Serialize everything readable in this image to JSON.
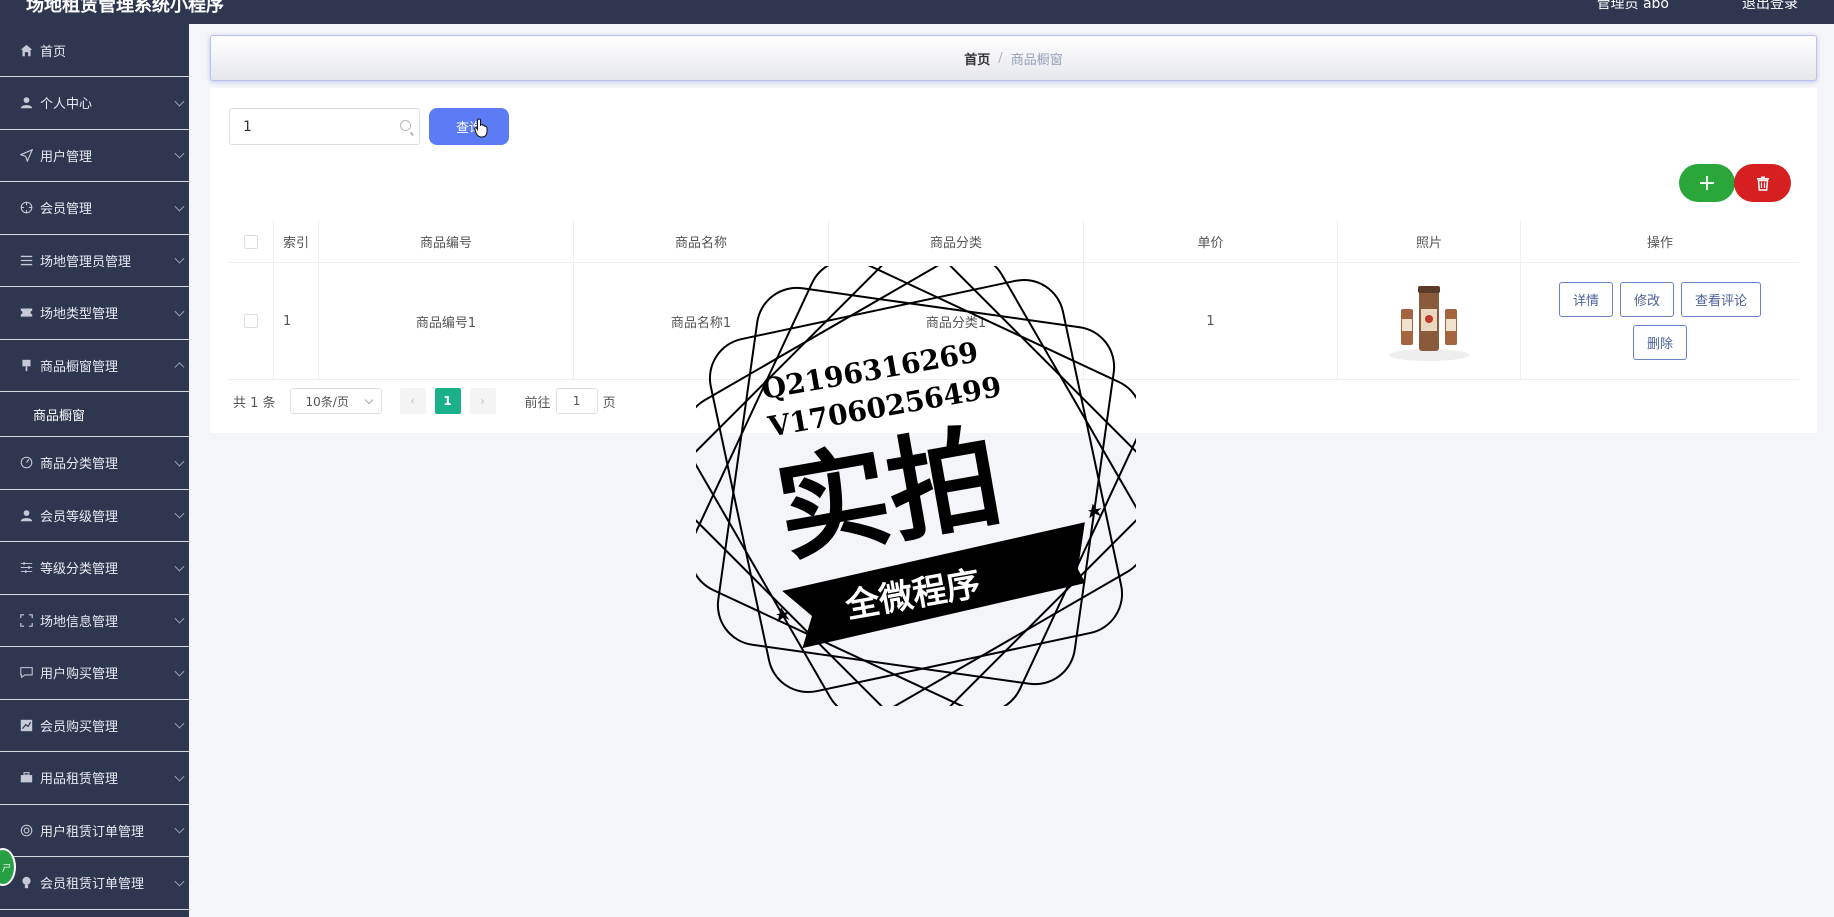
{
  "header": {
    "app_title": "场地租赁管理系统小程序",
    "user_label": "管理员 abo",
    "logout_label": "退出登录"
  },
  "sidebar": {
    "items": [
      {
        "label": "首页",
        "icon": "home-icon"
      },
      {
        "label": "个人中心",
        "icon": "user-icon"
      },
      {
        "label": "用户管理",
        "icon": "send-icon"
      },
      {
        "label": "会员管理",
        "icon": "target-icon"
      },
      {
        "label": "场地管理员管理",
        "icon": "list-icon"
      },
      {
        "label": "场地类型管理",
        "icon": "ticket-icon"
      },
      {
        "label": "商品橱窗管理",
        "icon": "pin-icon"
      },
      {
        "label": "商品分类管理",
        "icon": "gauge-icon"
      },
      {
        "label": "会员等级管理",
        "icon": "user-icon"
      },
      {
        "label": "等级分类管理",
        "icon": "sliders-icon"
      },
      {
        "label": "场地信息管理",
        "icon": "frame-icon"
      },
      {
        "label": "用户购买管理",
        "icon": "chat-icon"
      },
      {
        "label": "会员购买管理",
        "icon": "chart-icon"
      },
      {
        "label": "用品租赁管理",
        "icon": "briefcase-icon"
      },
      {
        "label": "用户租赁订单管理",
        "icon": "ring-icon"
      },
      {
        "label": "会员租赁订单管理",
        "icon": "bulb-icon"
      }
    ],
    "sub_item": "商品橱窗"
  },
  "breadcrumb": {
    "home": "首页",
    "separator": "/",
    "current": "商品橱窗"
  },
  "search": {
    "value": "1",
    "button_label": "查询"
  },
  "actions": {
    "add_symbol": "+",
    "delete_icon": "trash-icon"
  },
  "table": {
    "headers": [
      "",
      "索引",
      "商品编号",
      "商品名称",
      "商品分类",
      "单价",
      "照片",
      "操作"
    ],
    "rows": [
      {
        "index": "1",
        "code": "商品编号1",
        "name": "商品名称1",
        "category": "商品分类1",
        "price": "1",
        "photo_icon": "product-photo"
      }
    ],
    "row_buttons": {
      "detail": "详情",
      "edit": "修改",
      "review": "查看评论",
      "delete": "删除"
    }
  },
  "pagination": {
    "total": "共 1 条",
    "page_size": "10条/页",
    "current_page": "1",
    "goto_prefix": "前往",
    "goto_value": "1",
    "goto_suffix": "页"
  },
  "watermark": {
    "line1": "Q2196316269",
    "line2": "V17060256499",
    "big_text": "实拍",
    "ribbon": "全微程序"
  },
  "colors": {
    "sidebar_bg": "#2f3650",
    "query_button": "#5c7cf5",
    "add_button": "#2aa63a",
    "delete_button": "#d51f20",
    "active_page": "#19b08a"
  }
}
